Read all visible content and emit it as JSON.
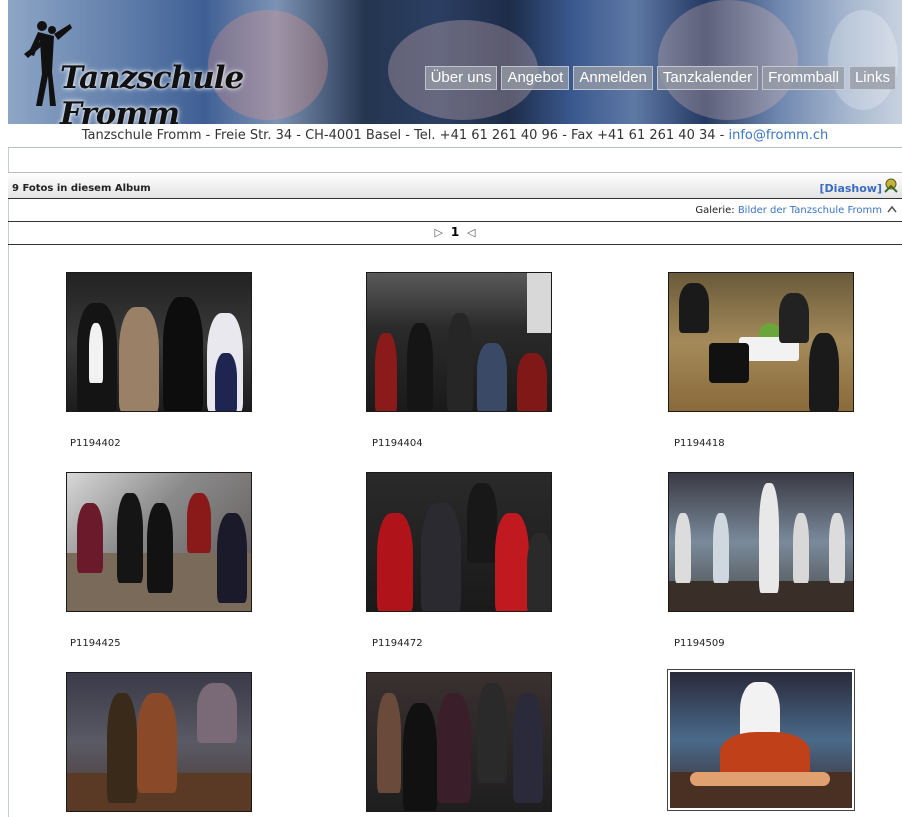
{
  "banner": {
    "logo_text": "Tanzschule Fromm",
    "nav": [
      "Über uns",
      "Angebot",
      "Anmelden",
      "Tanzkalender",
      "Frommball",
      "Links"
    ]
  },
  "info": {
    "address": "Tanzschule Fromm - Freie Str. 34 - CH-4001 Basel - Tel. +41 61 261 40 96 - Fax +41 61 261 40 34 - ",
    "email": "info@fromm.ch"
  },
  "album": {
    "count_label": "9 Fotos in diesem Album",
    "diashow_label": "[Diashow]",
    "galerie_label": "Galerie:",
    "galerie_link": "Bilder der Tanzschule Fromm",
    "page_prev": "▷",
    "page_current": "1",
    "page_next": "◁"
  },
  "photos": [
    {
      "caption": "P1194402"
    },
    {
      "caption": "P1194404"
    },
    {
      "caption": "P1194418"
    },
    {
      "caption": "P1194425"
    },
    {
      "caption": "P1194472"
    },
    {
      "caption": "P1194509"
    },
    {
      "caption": ""
    },
    {
      "caption": ""
    },
    {
      "caption": ""
    }
  ],
  "colors": {
    "link": "#3a74c4",
    "nav_button": "#9a9ba3"
  }
}
